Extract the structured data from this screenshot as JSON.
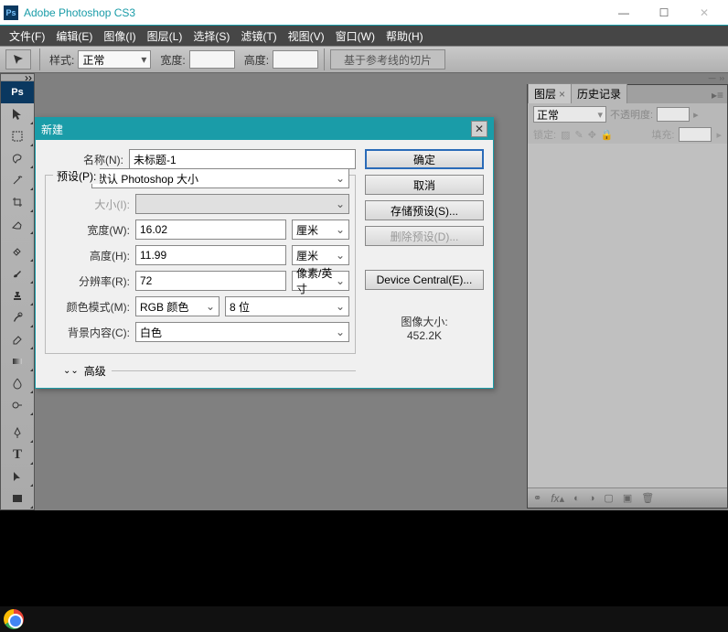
{
  "window": {
    "title": "Adobe Photoshop CS3"
  },
  "menu": [
    "文件(F)",
    "编辑(E)",
    "图像(I)",
    "图层(L)",
    "选择(S)",
    "滤镜(T)",
    "视图(V)",
    "窗口(W)",
    "帮助(H)"
  ],
  "options": {
    "style_label": "样式:",
    "style_value": "正常",
    "width_label": "宽度:",
    "height_label": "高度:",
    "slice_btn": "基于参考线的切片"
  },
  "layers": {
    "tab1": "图层",
    "tab2": "历史记录",
    "blend": "正常",
    "opacity_label": "不透明度:",
    "lock_label": "锁定:",
    "fill_label": "填充:"
  },
  "dialog": {
    "title": "新建",
    "name_label": "名称(N):",
    "name_value": "未标题-1",
    "preset_label": "预设(P):",
    "preset_value": "默认 Photoshop 大小",
    "size_label": "大小(I):",
    "width_label": "宽度(W):",
    "width_value": "16.02",
    "width_unit": "厘米",
    "height_label": "高度(H):",
    "height_value": "11.99",
    "height_unit": "厘米",
    "res_label": "分辨率(R):",
    "res_value": "72",
    "res_unit": "像素/英寸",
    "mode_label": "颜色模式(M):",
    "mode_value": "RGB 颜色",
    "mode_depth": "8 位",
    "bg_label": "背景内容(C):",
    "bg_value": "白色",
    "advanced": "高级",
    "ok": "确定",
    "cancel": "取消",
    "save_preset": "存储预设(S)...",
    "delete_preset": "删除预设(D)...",
    "device_central": "Device Central(E)...",
    "imgsize_label": "图像大小:",
    "imgsize_value": "452.2K"
  }
}
